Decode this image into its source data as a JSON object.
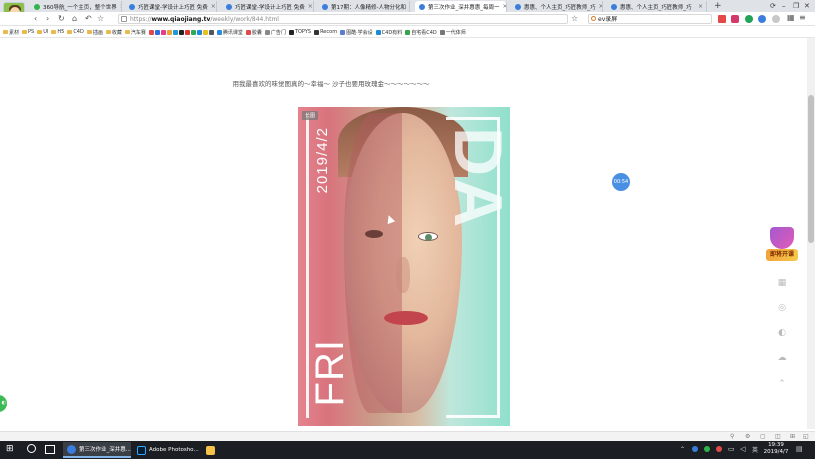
{
  "browser": {
    "tabs": [
      {
        "label": "360导航_一个主页，整个世界",
        "color": "#2fb44a"
      },
      {
        "label": "巧匠课堂-学设计上巧匠 免费",
        "color": "#3b7ddd"
      },
      {
        "label": "巧匠课堂-学设计上巧匠 免费",
        "color": "#3b7ddd"
      },
      {
        "label": "第17期：人像精修-人物分化和",
        "color": "#3b7ddd"
      },
      {
        "label": "第三次作业_深井惠惠_每周一 ",
        "color": "#3b7ddd",
        "active": true
      },
      {
        "label": "惠惠、个人主页_巧匠教师_巧",
        "color": "#3b7ddd"
      },
      {
        "label": "惠惠、个人主页_巧匠教师_巧",
        "color": "#3b7ddd"
      }
    ],
    "tab_close": "×",
    "new_tab": "+",
    "window_controls": [
      "⟳",
      "–",
      "❐",
      "✕"
    ],
    "nav": [
      "‹",
      "›",
      "↻",
      "⌂",
      "↶",
      "☆"
    ],
    "url_prefix": "https://",
    "url_domain": "www.qiaojiang.tv",
    "url_path": "/weekly/work/844.html",
    "search_value": "ev录屏",
    "search_icon": "search-icon"
  },
  "bookmarks": [
    {
      "label": "素材",
      "kind": "folder"
    },
    {
      "label": "PS",
      "kind": "folder"
    },
    {
      "label": "UI",
      "kind": "folder"
    },
    {
      "label": "H5",
      "kind": "folder"
    },
    {
      "label": "C4D",
      "kind": "folder"
    },
    {
      "label": "插画",
      "kind": "folder"
    },
    {
      "label": "收藏",
      "kind": "folder"
    },
    {
      "label": "汽车赛",
      "kind": "folder"
    },
    {
      "label": "腾讯课堂",
      "kind": "site",
      "color": "#2a8ce0"
    },
    {
      "label": "胶囊",
      "kind": "site",
      "color": "#e04a4a"
    },
    {
      "label": "广告门",
      "kind": "site",
      "color": "#888888"
    },
    {
      "label": "TOPYS",
      "kind": "site",
      "color": "#222222"
    },
    {
      "label": "Recom",
      "kind": "site",
      "color": "#333333"
    },
    {
      "label": "图酷·学会设",
      "kind": "site",
      "color": "#5b7bd5"
    },
    {
      "label": "C4D有料",
      "kind": "site",
      "color": "#1b8bd6"
    },
    {
      "label": "自宅看C4D",
      "kind": "site",
      "color": "#37a34a"
    },
    {
      "label": "一代体师",
      "kind": "site",
      "color": "#777777"
    }
  ],
  "page": {
    "caption": "用我最喜欢的味觉图真的～幸福～ 沙子也要用玫瑰金～～～～～～～",
    "poster": {
      "tag": "长图",
      "date": "2019/4/2",
      "day": "FRI",
      "big": "DA"
    },
    "timer": "00:54",
    "promo_label": "即将开课"
  },
  "side_icons": [
    "cart-icon",
    "chat-icon",
    "headset-icon",
    "coupon-icon",
    "top-icon"
  ],
  "side_glyphs": [
    "▦",
    "◎",
    "◐",
    "☁",
    "⌃"
  ],
  "taskbar": {
    "items": [
      {
        "label": "第三次作业_深井惠...",
        "color": "#3b7ddd",
        "open": true
      },
      {
        "label": "Adobe Photosho...",
        "color": "#31a8ff",
        "open": false
      },
      {
        "label": "",
        "color": "#f5c24a",
        "open": false
      }
    ],
    "time": "19:39",
    "date": "2019/4/7",
    "lang": "英"
  },
  "colors": {
    "accent": "#4a90e2",
    "poster_pink": "#e4848f",
    "poster_mint": "#8fe0cc"
  }
}
